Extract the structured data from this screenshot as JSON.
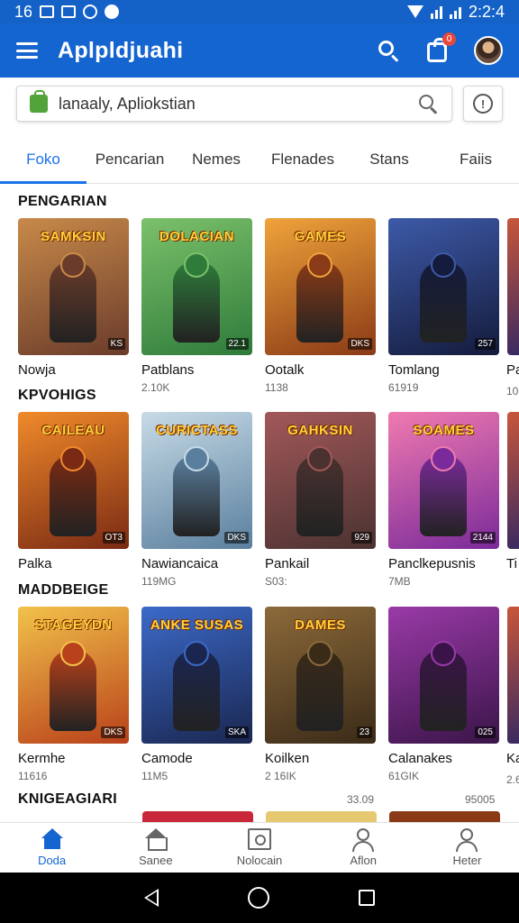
{
  "status_bar": {
    "time_left": "16",
    "time_right": "2:2:4"
  },
  "app_bar": {
    "title": "Aplpldjuahi",
    "cart_badge": "0"
  },
  "search": {
    "value": "lanaaly, Apliokstian"
  },
  "tabs": [
    {
      "label": "Foko",
      "active": true
    },
    {
      "label": "Pencarian",
      "active": false
    },
    {
      "label": "Nemes",
      "active": false
    },
    {
      "label": "Flenades",
      "active": false
    },
    {
      "label": "Stans",
      "active": false
    },
    {
      "label": "Faiis",
      "active": false
    }
  ],
  "sections": [
    {
      "title": "PENGARIAN",
      "peek_label": "Pa",
      "peek_sub": "10",
      "cards": [
        {
          "banner": "SAMKSIN",
          "name": "Nowja",
          "sub": "",
          "tag": "KS",
          "colors": [
            "#6a3b2a",
            "#c88a4a"
          ]
        },
        {
          "banner": "DOLACIAN",
          "name": "Patblans",
          "sub": "2.10K",
          "tag": "22.1",
          "colors": [
            "#2e7b3a",
            "#7cc16b"
          ]
        },
        {
          "banner": "GAMES",
          "name": "Ootalk",
          "sub": "1138",
          "tag": "DKS",
          "colors": [
            "#8a3a16",
            "#f0a33a"
          ]
        },
        {
          "banner": "",
          "name": "Tomlang",
          "sub": "61919",
          "tag": "257",
          "colors": [
            "#141b3c",
            "#3d5aa8"
          ]
        }
      ]
    },
    {
      "title": "KPVOHIGS",
      "peek_label": "Ti",
      "peek_sub": "",
      "cards": [
        {
          "banner": "CAILEAU",
          "name": "Palka",
          "sub": "",
          "tag": "OT3",
          "colors": [
            "#7a2a14",
            "#f08a2a"
          ]
        },
        {
          "banner": "CURICTASS",
          "name": "Nawiancaica",
          "sub": "119MG",
          "tag": "DKS",
          "colors": [
            "#5a7f9e",
            "#c7dbe6"
          ]
        },
        {
          "banner": "GAHKSIN",
          "name": "Pankail",
          "sub": "S03:",
          "tag": "929",
          "colors": [
            "#4a3230",
            "#a3585a"
          ]
        },
        {
          "banner": "SOAMES",
          "name": "Panclkepusnis",
          "sub": "7MB",
          "tag": "2144",
          "colors": [
            "#7a2a9a",
            "#f07ab0"
          ]
        }
      ]
    },
    {
      "title": "MADDBEIGE",
      "peek_label": "Ka",
      "peek_sub": "2.6",
      "cards": [
        {
          "banner": "STAGEYDN",
          "name": "Kermhe",
          "sub": "11616",
          "tag": "DKS",
          "colors": [
            "#b8401a",
            "#f2c24a"
          ]
        },
        {
          "banner": "ANKE SUSAS",
          "name": "Camode",
          "sub": "11M5",
          "tag": "SKA",
          "colors": [
            "#1a2650",
            "#3c6ac8"
          ]
        },
        {
          "banner": "DAMES",
          "name": "Koilken",
          "sub": "2 16IK",
          "tag": "23",
          "colors": [
            "#3a2a18",
            "#8c6a3a"
          ]
        },
        {
          "banner": "",
          "name": "Calanakes",
          "sub": "61GIK",
          "tag": "025",
          "colors": [
            "#3a1448",
            "#9a3aa8"
          ]
        }
      ],
      "extra": [
        "33.09",
        "95005"
      ]
    },
    {
      "title": "KNIGEAGIARI"
    }
  ],
  "bottom_nav": [
    {
      "label": "Doda",
      "icon": "home-icon",
      "active": true
    },
    {
      "label": "Sanee",
      "icon": "home-outline-icon",
      "active": false
    },
    {
      "label": "Nolocain",
      "icon": "library-icon",
      "active": false
    },
    {
      "label": "Aflon",
      "icon": "person-icon",
      "active": false
    },
    {
      "label": "Heter",
      "icon": "profile-icon",
      "active": false
    }
  ],
  "colors": {
    "primary": "#1565d0",
    "accent": "#1a73e8"
  }
}
